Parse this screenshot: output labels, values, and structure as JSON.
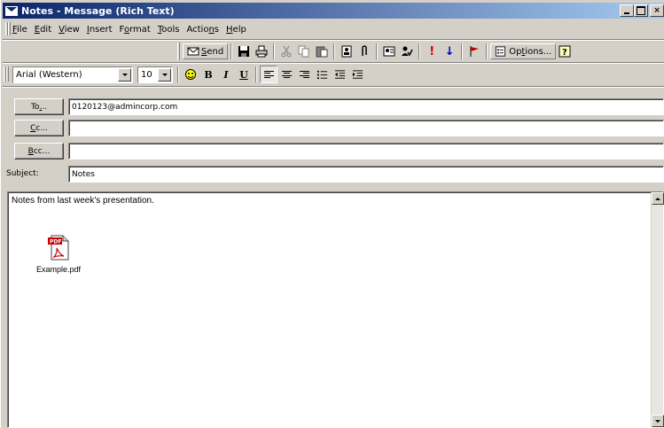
{
  "window": {
    "title": "Notes - Message (Rich Text)",
    "controls": {
      "close": "×"
    }
  },
  "menu": {
    "items": [
      {
        "label": "File",
        "u": "F",
        "rest": "ile"
      },
      {
        "label": "Edit",
        "u": "E",
        "rest": "dit"
      },
      {
        "label": "View",
        "u": "V",
        "rest": "iew"
      },
      {
        "label": "Insert",
        "u": "I",
        "rest": "nsert"
      },
      {
        "label": "Format",
        "pre": "F",
        "u": "o",
        "rest": "rmat"
      },
      {
        "label": "Tools",
        "u": "T",
        "rest": "ools"
      },
      {
        "label": "Actions",
        "pre": "Actio",
        "u": "n",
        "rest": "s"
      },
      {
        "label": "Help",
        "u": "H",
        "rest": "elp"
      }
    ]
  },
  "toolbar": {
    "send": {
      "u": "S",
      "rest": "end"
    },
    "options": {
      "pre": "Op",
      "u": "t",
      "rest": "ions..."
    },
    "importance_high": "!",
    "importance_low": "↓"
  },
  "formatting": {
    "font": "Arial (Western)",
    "size": "10",
    "bold": "B",
    "italic": "I",
    "underline": "U"
  },
  "address": {
    "to_button": {
      "pre": "To",
      "u": ".",
      "rest": ".."
    },
    "cc_button": {
      "u": "C",
      "rest": "c..."
    },
    "bcc_button": {
      "u": "B",
      "rest": "cc..."
    },
    "to_value": "0120123@admincorp.com",
    "cc_value": "",
    "bcc_value": "",
    "subject_label": {
      "pre": "Sub",
      "u": "j",
      "rest": "ect:"
    },
    "subject_value": "Notes"
  },
  "message": {
    "body": "Notes from last week's presentation.",
    "attachment": {
      "filename": "Example.pdf",
      "badge": "PDF"
    }
  },
  "colors": {
    "title_start": "#0a246a",
    "title_end": "#a6caf0",
    "chrome": "#d4d0c8",
    "pdf_red": "#cc0000"
  }
}
